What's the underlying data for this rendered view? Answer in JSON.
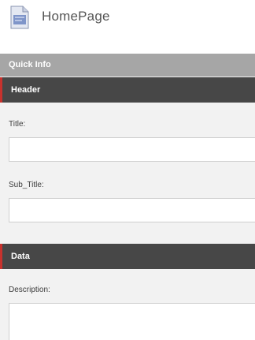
{
  "item": {
    "title": "HomePage",
    "icon": "document-page-icon"
  },
  "quick_info": {
    "label": "Quick Info"
  },
  "sections": {
    "header": {
      "label": "Header",
      "fields": {
        "title": {
          "label": "Title:",
          "value": ""
        },
        "sub_title": {
          "label": "Sub_Title:",
          "value": ""
        }
      }
    },
    "data": {
      "label": "Data",
      "fields": {
        "description": {
          "label": "Description:",
          "value": ""
        }
      }
    }
  },
  "colors": {
    "accent": "#c8322d",
    "section_header_bg": "#474747",
    "quick_info_bg": "#a6a6a6",
    "editor_bg": "#f2f2f2"
  }
}
